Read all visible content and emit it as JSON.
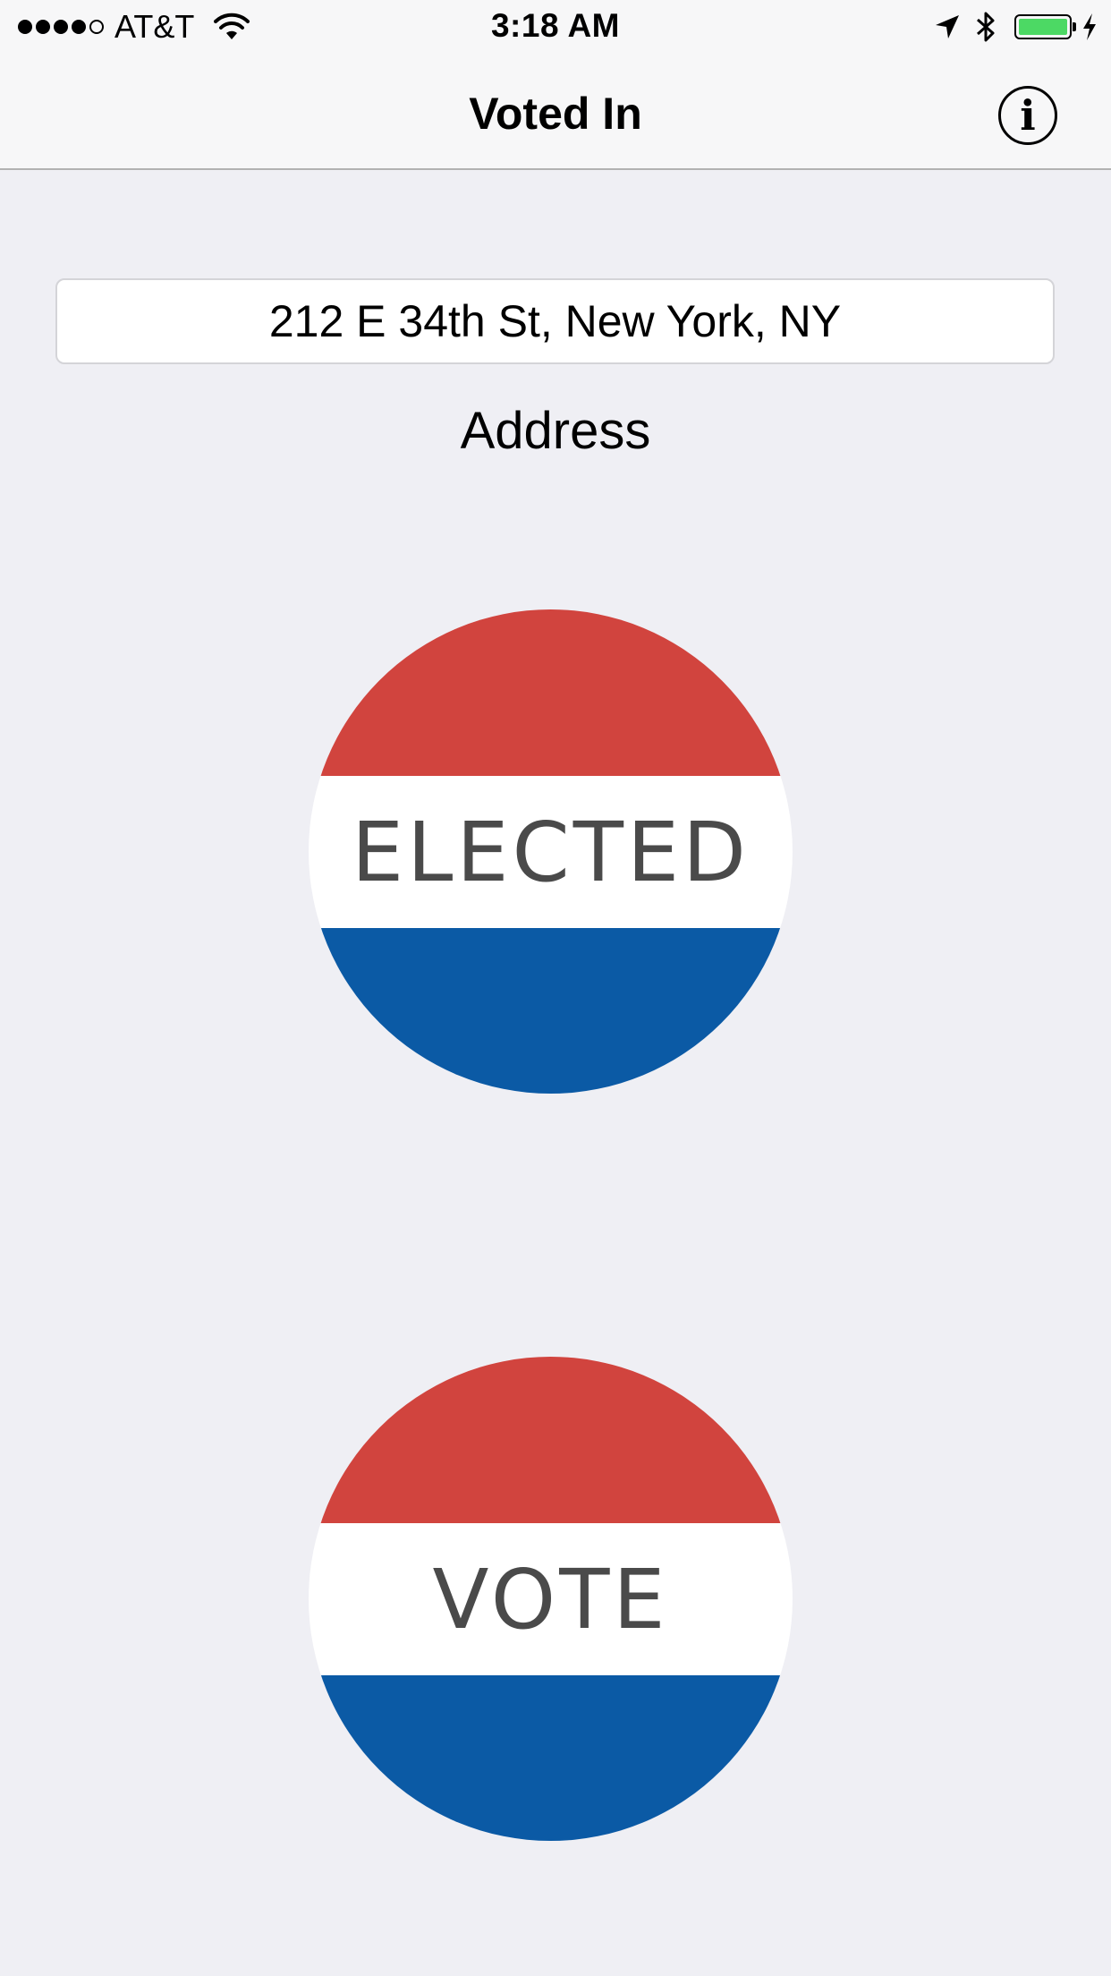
{
  "status_bar": {
    "carrier": "AT&T",
    "time": "3:18 AM",
    "signal_bars_filled": 4,
    "signal_bars_total": 5,
    "battery_level": 1.0,
    "icons": [
      "wifi-icon",
      "location-arrow-icon",
      "bluetooth-icon",
      "battery-icon",
      "charging-bolt-icon"
    ]
  },
  "nav": {
    "title": "Voted In",
    "info_icon": "i"
  },
  "address": {
    "value": "212 E 34th St, New York, NY",
    "label": "Address"
  },
  "badges": {
    "elected_label": "ELECTED",
    "vote_label": "VOTE"
  },
  "colors": {
    "background": "#efeff4",
    "badge_red": "#d1443e",
    "badge_white": "#ffffff",
    "badge_blue": "#0b5aa5",
    "badge_text": "#4a4a4a",
    "battery_green": "#4cd964"
  }
}
